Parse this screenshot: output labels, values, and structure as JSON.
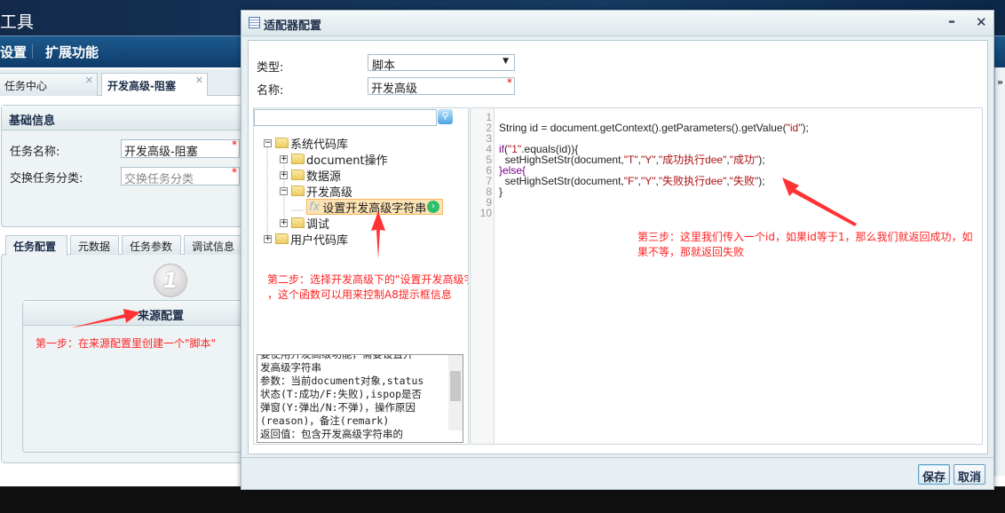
{
  "app": {
    "title": "工具",
    "nav": [
      "设置",
      "扩展功能"
    ]
  },
  "tabs": [
    {
      "label": "任务中心"
    },
    {
      "label": "开发高级-阻塞"
    }
  ],
  "basic_info": {
    "title": "基础信息",
    "name_label": "任务名称:",
    "name_value": "开发高级-阻塞",
    "category_label": "交换任务分类:",
    "category_placeholder": "交换任务分类"
  },
  "sub_tabs": [
    "任务配置",
    "元数据",
    "任务参数",
    "调试信息"
  ],
  "step_badge": "1",
  "source_panel": {
    "title": "来源配置"
  },
  "annotations": {
    "step1": "第一步：在来源配置里创建一个\"脚本\"",
    "step2_line1": "第二步：选择开发高级下的\"设置开发高级字符串\"",
    "step2_line2": "，这个函数可以用来控制A8提示框信息",
    "step3_line1": "第三步：这里我们传入一个id，如果id等于1，那么我们就返回成功，如",
    "step3_line2": "果不等，那就返回失败"
  },
  "dialog": {
    "title": "适配器配置",
    "type_label": "类型:",
    "type_value": "脚本",
    "name_label": "名称:",
    "name_value": "开发高级",
    "save": "保存",
    "cancel": "取消"
  },
  "tree": {
    "search_value": "",
    "items": [
      {
        "label": "系统代码库"
      },
      {
        "label": "document操作"
      },
      {
        "label": "数据源"
      },
      {
        "label": "开发高级"
      },
      {
        "label": "设置开发高级字符串"
      },
      {
        "label": "调试"
      },
      {
        "label": "用户代码库"
      }
    ]
  },
  "description": [
    "要使用开发高级功能，需要设置开",
    "发高级字符串",
    "参数：当前document对象,status",
    "状态(T:成功/F:失败),ispop是否",
    "弹窗(Y:弹出/N:不弹)，操作原因",
    "(reason)，备注(remark)",
    "返回值：包含开发高级字符串的"
  ],
  "code_lines": [
    "",
    "String id = document.getContext().getParameters().getValue(\"id\");",
    "",
    "if(\"1\".equals(id)){",
    "  setHighSetStr(document,\"T\",\"Y\",\"成功执行dee\",\"成功\");",
    "}else{",
    "  setHighSetStr(document,\"F\",\"Y\",\"失败执行dee\",\"失败\");",
    "}",
    "",
    ""
  ],
  "line_numbers": [
    "1",
    "2",
    "3",
    "4",
    "5",
    "6",
    "7",
    "8",
    "9",
    "10"
  ]
}
